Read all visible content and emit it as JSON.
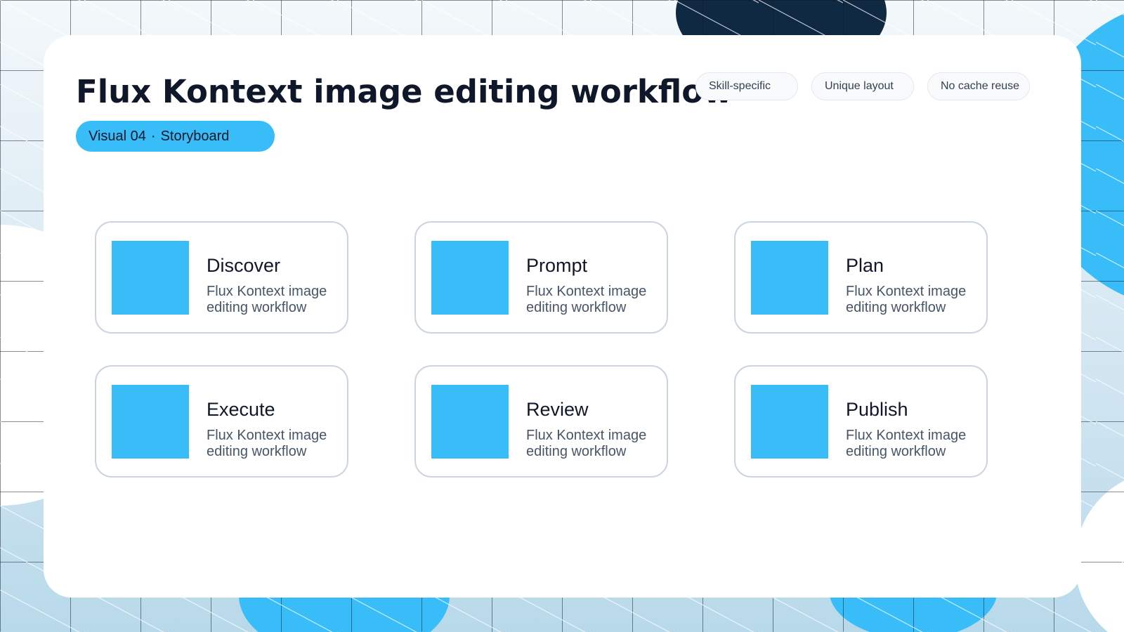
{
  "header": {
    "title": "Flux Kontext image editing workflow",
    "subtitle_visual": "Visual 04",
    "subtitle_separator": "·",
    "subtitle_kind": "Storyboard"
  },
  "tags": [
    {
      "label": "Skill-specific"
    },
    {
      "label": "Unique layout"
    },
    {
      "label": "No cache reuse"
    }
  ],
  "steps": [
    {
      "title": "Discover",
      "description": "Flux Kontext image editing workflow"
    },
    {
      "title": "Prompt",
      "description": "Flux Kontext image editing workflow"
    },
    {
      "title": "Plan",
      "description": "Flux Kontext image editing workflow"
    },
    {
      "title": "Execute",
      "description": "Flux Kontext image editing workflow"
    },
    {
      "title": "Review",
      "description": "Flux Kontext image editing workflow"
    },
    {
      "title": "Publish",
      "description": "Flux Kontext image editing workflow"
    }
  ],
  "colors": {
    "accent": "#38bdf8",
    "navy": "#0f2942",
    "background_light": "#b8d9ea",
    "text_primary": "#0f172a",
    "text_secondary": "#475569",
    "card_border": "#cbd5e1"
  }
}
